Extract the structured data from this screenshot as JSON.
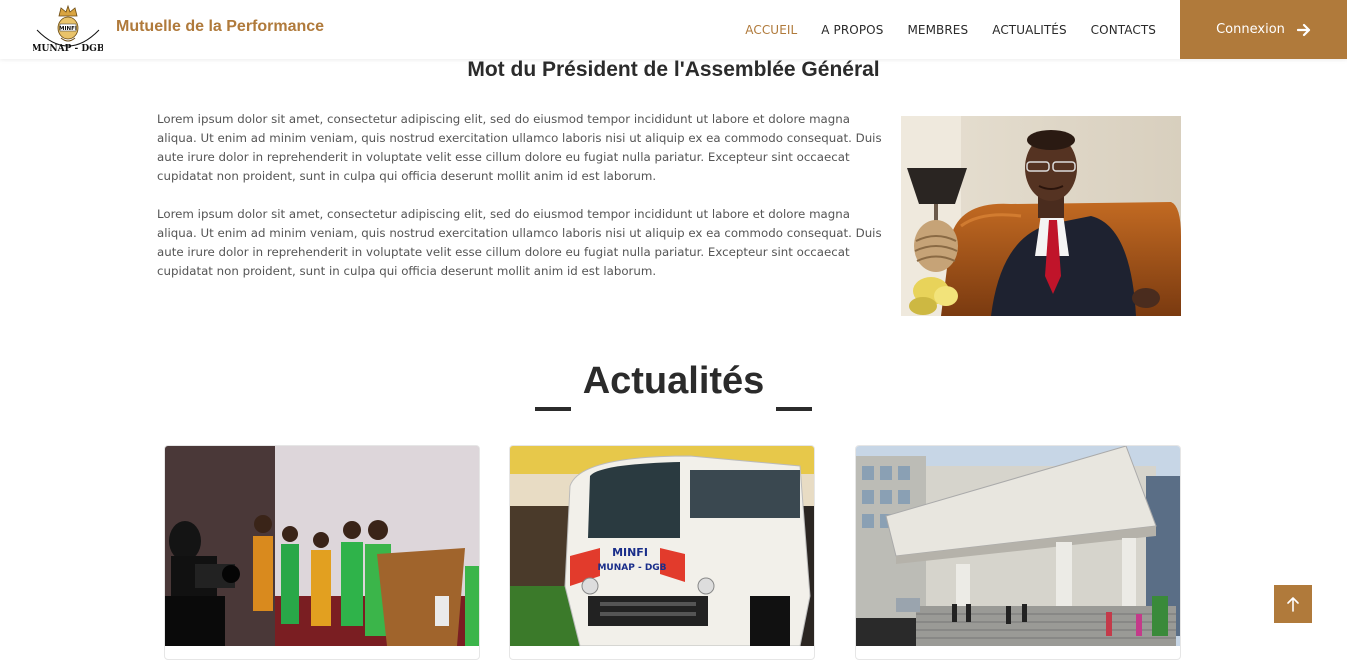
{
  "navbar": {
    "logo_icon": "munap-dgb-logo-icon",
    "logo_top_text": "MINFI",
    "logo_bottom_text": "MUNAP - DGB",
    "brand": "Mutuelle de la Performance",
    "links": [
      {
        "label": "ACCUEIL",
        "active": true
      },
      {
        "label": "A PROPOS",
        "active": false
      },
      {
        "label": "MEMBRES",
        "active": false
      },
      {
        "label": "ACTUALITÉS",
        "active": false
      },
      {
        "label": "CONTACTS",
        "active": false
      }
    ],
    "login_label": "Connexion",
    "login_icon": "arrow-right-icon"
  },
  "president": {
    "title": "Mot du Président de l'Assemblée Général",
    "paragraphs": [
      "Lorem ipsum dolor sit amet, consectetur adipiscing elit, sed do eiusmod tempor incididunt ut labore et dolore magna aliqua. Ut enim ad minim veniam, quis nostrud exercitation ullamco laboris nisi ut aliquip ex ea commodo consequat. Duis aute irure dolor in reprehenderit in voluptate velit esse cillum dolore eu fugiat nulla pariatur. Excepteur sint occaecat cupidatat non proident, sunt in culpa qui officia deserunt mollit anim id est laborum.",
      "Lorem ipsum dolor sit amet, consectetur adipiscing elit, sed do eiusmod tempor incididunt ut labore et dolore magna aliqua. Ut enim ad minim veniam, quis nostrud exercitation ullamco laboris nisi ut aliquip ex ea commodo consequat. Duis aute irure dolor in reprehenderit in voluptate velit esse cillum dolore eu fugiat nulla pariatur. Excepteur sint occaecat cupidatat non proident, sunt in culpa qui officia deserunt mollit anim id est laborum."
    ],
    "photo": "president-portrait-photo"
  },
  "news": {
    "heading": "Actualités",
    "cards": [
      {
        "image": "ceremony-stage-photo"
      },
      {
        "image": "minibus-photo",
        "vehicle_text_1": "MINFI",
        "vehicle_text_2": "MUNAP - DGB"
      },
      {
        "image": "building-entrance-photo"
      }
    ]
  },
  "scroll_top": {
    "icon": "arrow-up-icon"
  },
  "colors": {
    "accent": "#b07a3b",
    "text_dark": "#2b2b2b",
    "text_body": "#555555"
  }
}
